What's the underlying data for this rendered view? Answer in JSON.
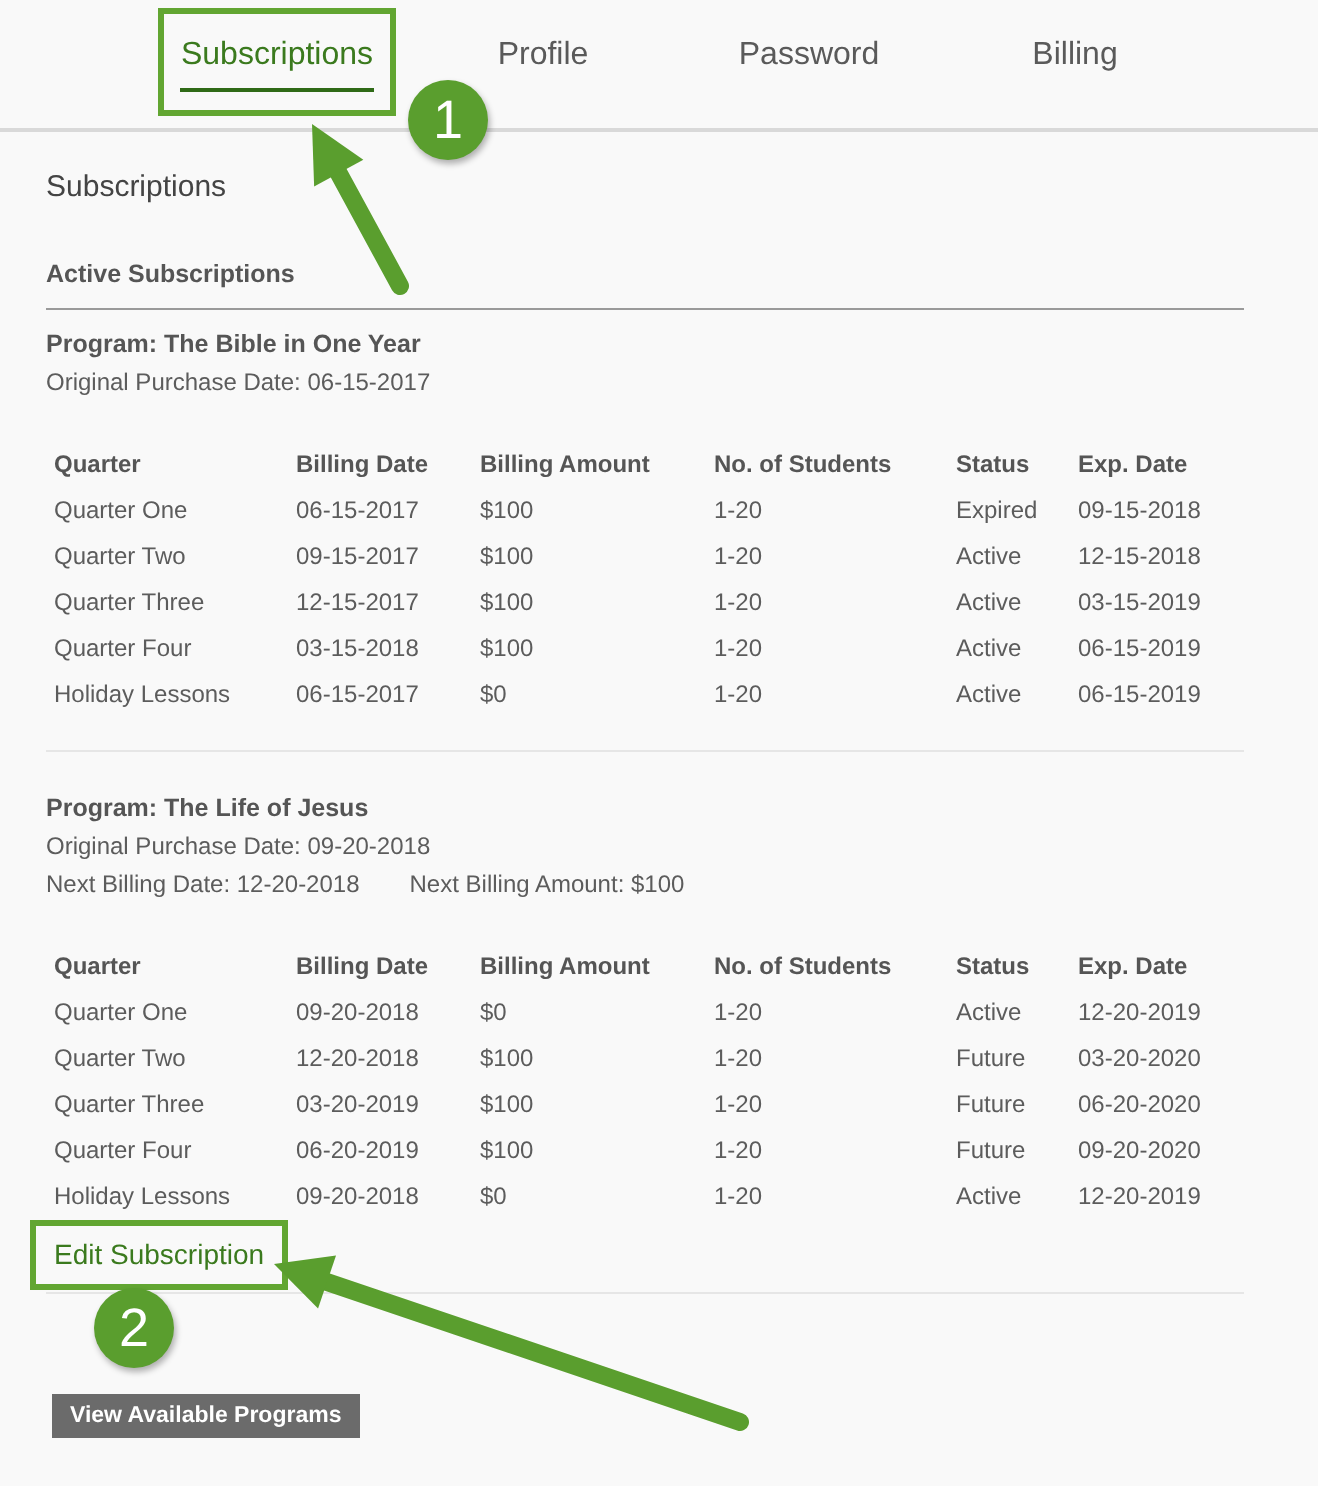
{
  "tabs": [
    {
      "label": "Subscriptions",
      "selected": true,
      "highlighted": true
    },
    {
      "label": "Profile",
      "selected": false,
      "highlighted": false
    },
    {
      "label": "Password",
      "selected": false,
      "highlighted": false
    },
    {
      "label": "Billing",
      "selected": false,
      "highlighted": false
    }
  ],
  "page_title": "Subscriptions",
  "section_title": "Active Subscriptions",
  "programs": [
    {
      "title": "Program: The Bible in One Year",
      "details": [
        [
          "Original Purchase Date: 06-15-2017"
        ]
      ],
      "table": {
        "columns": [
          "Quarter",
          "Billing Date",
          "Billing Amount",
          "No. of Students",
          "Status",
          "Exp. Date"
        ],
        "rows": [
          [
            "Quarter One",
            "06-15-2017",
            "$100",
            "1-20",
            "Expired",
            "09-15-2018"
          ],
          [
            "Quarter Two",
            "09-15-2017",
            "$100",
            "1-20",
            "Active",
            "12-15-2018"
          ],
          [
            "Quarter Three",
            "12-15-2017",
            "$100",
            "1-20",
            "Active",
            "03-15-2019"
          ],
          [
            "Quarter Four",
            "03-15-2018",
            "$100",
            "1-20",
            "Active",
            "06-15-2019"
          ],
          [
            "Holiday Lessons",
            "06-15-2017",
            "$0",
            "1-20",
            "Active",
            "06-15-2019"
          ]
        ]
      }
    },
    {
      "title": "Program: The Life of Jesus",
      "details": [
        [
          "Original Purchase Date: 09-20-2018"
        ],
        [
          "Next Billing Date: 12-20-2018",
          "Next Billing Amount: $100"
        ]
      ],
      "table": {
        "columns": [
          "Quarter",
          "Billing Date",
          "Billing Amount",
          "No. of Students",
          "Status",
          "Exp. Date"
        ],
        "rows": [
          [
            "Quarter One",
            "09-20-2018",
            "$0",
            "1-20",
            "Active",
            "12-20-2019"
          ],
          [
            "Quarter Two",
            "12-20-2018",
            "$100",
            "1-20",
            "Future",
            "03-20-2020"
          ],
          [
            "Quarter Three",
            "03-20-2019",
            "$100",
            "1-20",
            "Future",
            "06-20-2020"
          ],
          [
            "Quarter Four",
            "06-20-2019",
            "$100",
            "1-20",
            "Future",
            "09-20-2020"
          ],
          [
            "Holiday Lessons",
            "09-20-2018",
            "$0",
            "1-20",
            "Active",
            "12-20-2019"
          ]
        ]
      },
      "action": {
        "label": "Edit Subscription",
        "highlighted": true
      }
    }
  ],
  "button": "View Available Programs",
  "callouts": [
    {
      "number": "1"
    },
    {
      "number": "2"
    }
  ]
}
